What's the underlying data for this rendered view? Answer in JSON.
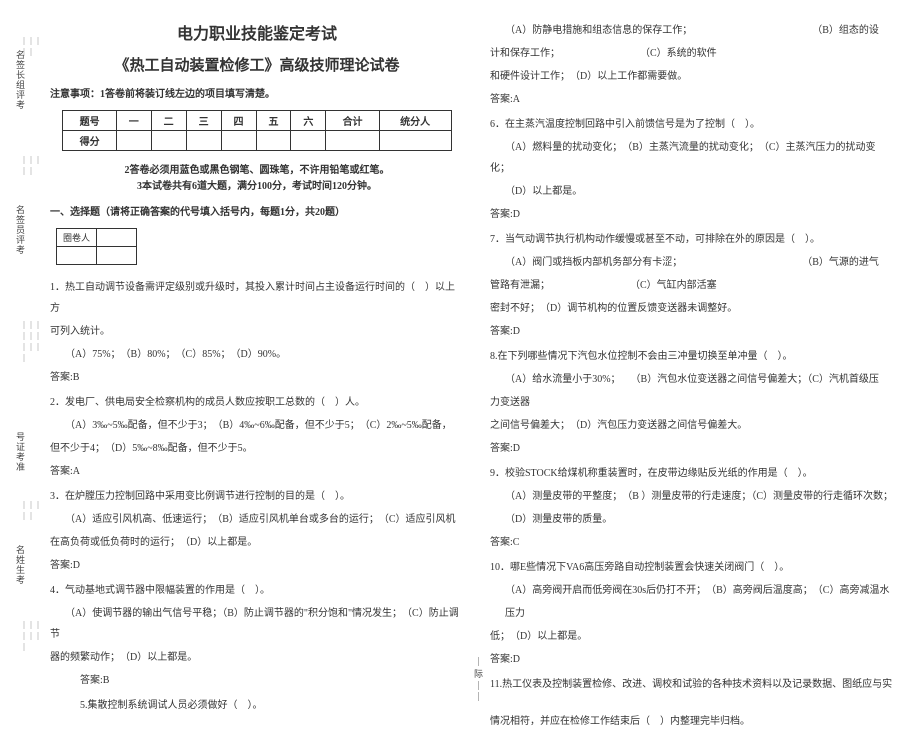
{
  "margin": {
    "line1": "名签长组评考",
    "line2": "名签员评考",
    "line3": "号证考准",
    "line4": "名姓生考"
  },
  "header": {
    "title1": "电力职业技能鉴定考试",
    "title2": "《热工自动装置检修工》高级技师理论试卷",
    "notice": "注意事项：1答卷前将装订线左边的项目填写清楚。"
  },
  "scoreTable": {
    "h0": "题号",
    "h1": "一",
    "h2": "二",
    "h3": "三",
    "h4": "四",
    "h5": "五",
    "h6": "六",
    "h7": "合计",
    "h8": "统分人",
    "r0": "得分"
  },
  "instructions": {
    "line1": "2答卷必须用蓝色或黑色钢笔、圆珠笔，不许用铅笔或红笔。",
    "line2": "3本试卷共有6道大题，满分100分，考试时间120分钟。"
  },
  "section1": "一、选择题（请将正确答案的代号填入括号内，每题1分，共20题）",
  "miniTable": {
    "c0": "圈卷人"
  },
  "q1": {
    "text": "1．热工自动调节设备需评定级别或升级时，其投入累计时间占主设备运行时间的（　）以上方",
    "text2": "可列入统计。",
    "opts": "（A）75%；　（B）80%；　（C）85%；　（D）90%。",
    "ans": "答案:B"
  },
  "q2": {
    "text": "2．发电厂、供电局安全检察机构的成员人数应按职工总数的（　）人。",
    "opts": "（A）3‰~5‰配备，但不少于3；　（B）4‰~6‰配备，但不少于5；　（C）2‰~5‰配备，",
    "opts2": "但不少于4；　（D）5‰~8‰配备，但不少于5。",
    "ans": "答案:A"
  },
  "q3": {
    "text": "3．在炉膛压力控制回路中采用变比例调节进行控制的目的是（　）。",
    "opts": "（A）适应引风机高、低速运行；　（B）适应引风机单台或多台的运行；　（C）适应引风机",
    "opts2": "在高负荷或低负荷时的运行；　（D）以上都是。",
    "ans": "答案:D"
  },
  "q4": {
    "text": "4．气动基地式调节器中限幅装置的作用是（　）。",
    "opts": "（A）使调节器的输出气信号平稳；（B）防止调节器的\"积分饱和\"情况发生；　（C）防止调节",
    "opts2": "器的频繁动作；　（D）以上都是。",
    "ans": "答案:B"
  },
  "q5": {
    "text": "5.集散控制系统调试人员必须做好（　）。"
  },
  "r5": {
    "l1": "（A）防静电措施和组态信息的保存工作；　　　　　　　　　　　　　（B）组态的设",
    "l2": "计和保存工作；　　　　　　　　　（C）系统的软件",
    "l3": "和硬件设计工作；　（D）以上工作都需要做。",
    "ans": "答案:A"
  },
  "q6": {
    "text": "6．在主蒸汽温度控制回路中引入前馈信号是为了控制（　）。",
    "opts": "（A）燃料量的扰动变化；　（B）主蒸汽流量的扰动变化；　（C）主蒸汽压力的扰动变化；",
    "opts2": "（D）以上都是。",
    "ans": "答案:D"
  },
  "q7": {
    "text": "7．当气动调节执行机构动作缓慢或甚至不动，可排除在外的原因是（　）。",
    "opts": "（A）阀门或挡板内部机务部分有卡涩；　　　　　　　　　　　　　（B）气源的进气",
    "opts2": "管路有泄漏；　　　　　　　　　（C）气缸内部活塞",
    "opts3": "密封不好；　（D）调节机构的位置反馈变送器未调整好。",
    "ans": "答案:D"
  },
  "q8": {
    "text": "8.在下列哪些情况下汽包水位控制不会由三冲量切换至单冲量（　）。",
    "opts": "（A）给水流量小于30%；　　（B）汽包水位变送器之间信号偏差大；（C）汽机首级压",
    "opts2": "力变送器",
    "opts3": "之间信号偏差大；　（D）汽包压力变送器之间信号偏差大。",
    "ans": "答案:D"
  },
  "q9": {
    "text": "9．校验STOCK给煤机称重装置时，在皮带边缘贴反光纸的作用是（　）。",
    "opts": "（A）测量皮带的平整度；　（B ）测量皮带的行走速度；（C）测量皮带的行走循环次数；",
    "opts2": "（D）测量皮带的质量。",
    "ans": "答案:C"
  },
  "q10": {
    "text": "10．哪E些情况下VA6高压旁路自动控制装置会快速关闭阀门（　）。",
    "opts": "（A）高旁阀开启而低旁阀在30s后仍打不开；　（B）高旁阀后温度高；　（C）高旁减温水",
    "opts2": "压力",
    "opts3": "低；　（D）以上都是。",
    "ans": "答案:D"
  },
  "q11": {
    "text": "11.热工仪表及控制装置检修、改进、调校和试验的各种技术资料以及记录数据、图纸应与实",
    "text2": "际",
    "text3": "情况相符，并应在检修工作结束后（　）内整理完毕归档。"
  },
  "divider": "｜｜｜"
}
